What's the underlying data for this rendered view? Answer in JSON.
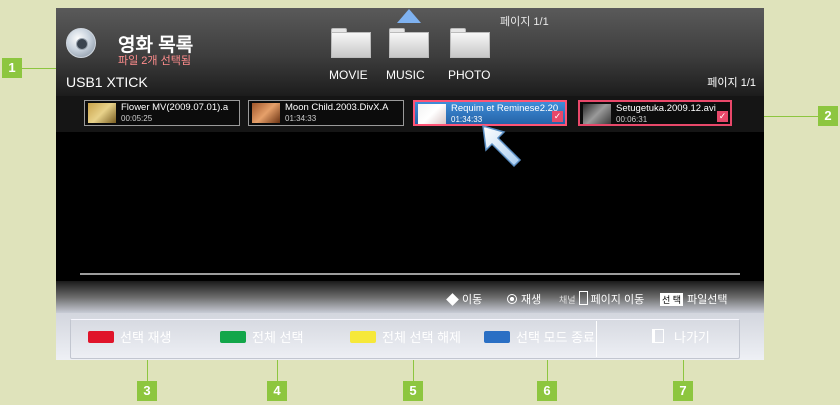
{
  "header": {
    "title": "영화 목록",
    "subtitle": "파일 2개 선택됨",
    "device": "USB1 XTICK",
    "page_top": "페이지 1/1",
    "page_right": "페이지 1/1"
  },
  "categories": [
    {
      "label": "MOVIE",
      "icon": "folder-icon"
    },
    {
      "label": "MUSIC",
      "icon": "folder-icon"
    },
    {
      "label": "PHOTO",
      "icon": "folder-icon"
    }
  ],
  "files": [
    {
      "name": "Flower MV(2009.07.01).a",
      "duration": "00:05:25",
      "selected": false,
      "focused": false
    },
    {
      "name": "Moon Child.2003.DivX.A",
      "duration": "01:34:33",
      "selected": false,
      "focused": false
    },
    {
      "name": "Requim et Reminese2.20",
      "duration": "01:34:33",
      "selected": true,
      "focused": true
    },
    {
      "name": "Setugetuka.2009.12.avi",
      "duration": "00:06:31",
      "selected": true,
      "focused": false
    }
  ],
  "help": {
    "move": "이동",
    "play": "재생",
    "channel": "채널",
    "page_move": "페이지 이동",
    "select_key": "선 택",
    "file_select": "파일선택"
  },
  "buttons": {
    "red": "선택 재생",
    "green": "전체 선택",
    "yellow": "전체 선택 해제",
    "blue": "선택 모드 종료",
    "exit": "나가기"
  },
  "colors": {
    "red": "#e0142a",
    "green": "#12a64a",
    "yellow": "#f6e83a",
    "blue": "#2a6fc4",
    "callout": "#8dc63f"
  },
  "callouts": [
    "1",
    "2",
    "3",
    "4",
    "5",
    "6",
    "7"
  ]
}
